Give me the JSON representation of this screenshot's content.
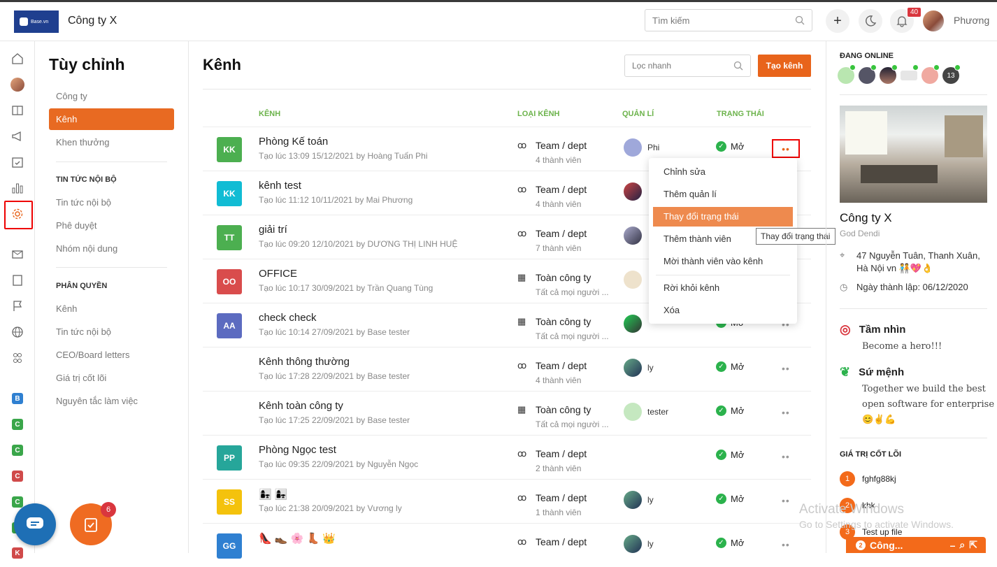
{
  "header": {
    "logo_text": "Base.vn",
    "company": "Công ty X",
    "search_placeholder": "Tìm kiếm",
    "notif_count": "40",
    "user_name": "Phương"
  },
  "rail": {
    "letters": [
      "B",
      "C",
      "C",
      "C",
      "C",
      "C",
      "K"
    ],
    "letter_colors": [
      "#2f80d1",
      "#3aa64a",
      "#3aa64a",
      "#d04a4a",
      "#3aa64a",
      "#3aa64a",
      "#d04a4a"
    ]
  },
  "sidebar": {
    "title": "Tùy chỉnh",
    "items_top": [
      "Công ty",
      "Kênh",
      "Khen thưởng"
    ],
    "active": "Kênh",
    "section1": "TIN TỨC NỘI BỘ",
    "items_news": [
      "Tin tức nội bộ",
      "Phê duyệt",
      "Nhóm nội dung"
    ],
    "section2": "PHÂN QUYỀN",
    "items_perm": [
      "Kênh",
      "Tin tức nội bộ",
      "CEO/Board letters",
      "Giá trị cốt lõi",
      "Nguyên tắc làm việc"
    ]
  },
  "main": {
    "title": "Kênh",
    "filter_placeholder": "Lọc nhanh",
    "create_label": "Tạo kênh",
    "columns": [
      "KÊNH",
      "LOẠI KÊNH",
      "QUẢN LÍ",
      "TRẠNG THÁI"
    ],
    "rows": [
      {
        "badge": "KK",
        "color": "#4caf50",
        "name": "Phòng Kế toán",
        "created": "Tạo lúc 13:09 15/12/2021 by Hoàng Tuấn Phi",
        "type": "Team / dept",
        "members": "4 thành viên",
        "manager": "Phi",
        "status": "Mở"
      },
      {
        "badge": "KK",
        "color": "#11bcd4",
        "name": "kênh test",
        "created": "Tạo lúc 11:12 10/11/2021 by Mai Phương",
        "type": "Team / dept",
        "members": "4 thành viên",
        "manager": "",
        "status": ""
      },
      {
        "badge": "TT",
        "color": "#4caf50",
        "name": "giải trí",
        "created": "Tạo lúc 09:20 12/10/2021 by DƯƠNG THỊ LINH HUỆ",
        "type": "Team / dept",
        "members": "7 thành viên",
        "manager": "",
        "status": ""
      },
      {
        "badge": "OO",
        "color": "#d94c4c",
        "name": "OFFICE",
        "created": "Tạo lúc 10:17 30/09/2021 by Trần Quang Tùng",
        "type": "Toàn công ty",
        "members": "Tất cả mọi người ...",
        "manager": "",
        "status": ""
      },
      {
        "badge": "AA",
        "color": "#5c6bc0",
        "name": "check check",
        "created": "Tạo lúc 10:14 27/09/2021 by Base tester",
        "type": "Toàn công ty",
        "members": "Tất cả mọi người ...",
        "manager": "",
        "status": "Mở"
      },
      {
        "badge": "",
        "color": "",
        "name": "Kênh thông thường",
        "created": "Tạo lúc 17:28 22/09/2021 by Base tester",
        "type": "Team / dept",
        "members": "4 thành viên",
        "manager": "ly",
        "status": "Mở"
      },
      {
        "badge": "",
        "color": "",
        "name": "Kênh toàn công ty",
        "created": "Tạo lúc 17:25 22/09/2021 by Base tester",
        "type": "Toàn công ty",
        "members": "Tất cả mọi người ...",
        "manager": "tester",
        "status": "Mở"
      },
      {
        "badge": "PP",
        "color": "#26a69a",
        "name": "Phòng Ngọc test",
        "created": "Tạo lúc 09:35 22/09/2021 by Nguyễn Ngọc",
        "type": "Team / dept",
        "members": "2 thành viên",
        "manager": "",
        "status": "Mở"
      },
      {
        "badge": "SS",
        "color": "#f4c20d",
        "name": "👩‍👧 👩‍👧",
        "created": "Tạo lúc 21:38 20/09/2021 by Vương ly",
        "type": "Team / dept",
        "members": "1 thành viên",
        "manager": "ly",
        "status": "Mở"
      },
      {
        "badge": "GG",
        "color": "#2f80d1",
        "name": "👠 👞 🌸 👢 👑",
        "created": "",
        "type": "Team / dept",
        "members": "",
        "manager": "ly",
        "status": "Mở"
      }
    ]
  },
  "context_menu": {
    "items": [
      "Chỉnh sửa",
      "Thêm quản lí",
      "Thay đổi trạng thái",
      "Thêm thành viên",
      "Mời thành viên vào kênh",
      "Rời khỏi kênh",
      "Xóa"
    ],
    "active": "Thay đổi trạng thái",
    "tooltip": "Thay đổi trạng thái"
  },
  "right": {
    "online_title": "ĐANG ONLINE",
    "online_more": "13",
    "company": "Công ty X",
    "subtitle": "God Dendi",
    "address": "47 Nguyễn Tuân, Thanh Xuân, Hà Nội vn 🧑‍🤝‍🧑💖👌",
    "founded": "Ngày thành lập: 06/12/2020",
    "vision_title": "Tầm nhìn",
    "vision_text": "Become a hero!!!",
    "mission_title": "Sứ mệnh",
    "mission_text": "Together we build the best open software for enterprise 😊✌️💪",
    "values_title": "GIÁ TRỊ CỐT LÕI",
    "values": [
      {
        "num": "1",
        "text": "fghfg88kj"
      },
      {
        "num": "2",
        "text": "khk"
      },
      {
        "num": "3",
        "text": "Test up file"
      }
    ]
  },
  "chat": {
    "count": "2",
    "label": "Công..."
  },
  "fab": {
    "task_count": "6"
  },
  "watermark": {
    "line1": "Activate Windows",
    "line2": "Go to Settings to activate Windows."
  }
}
